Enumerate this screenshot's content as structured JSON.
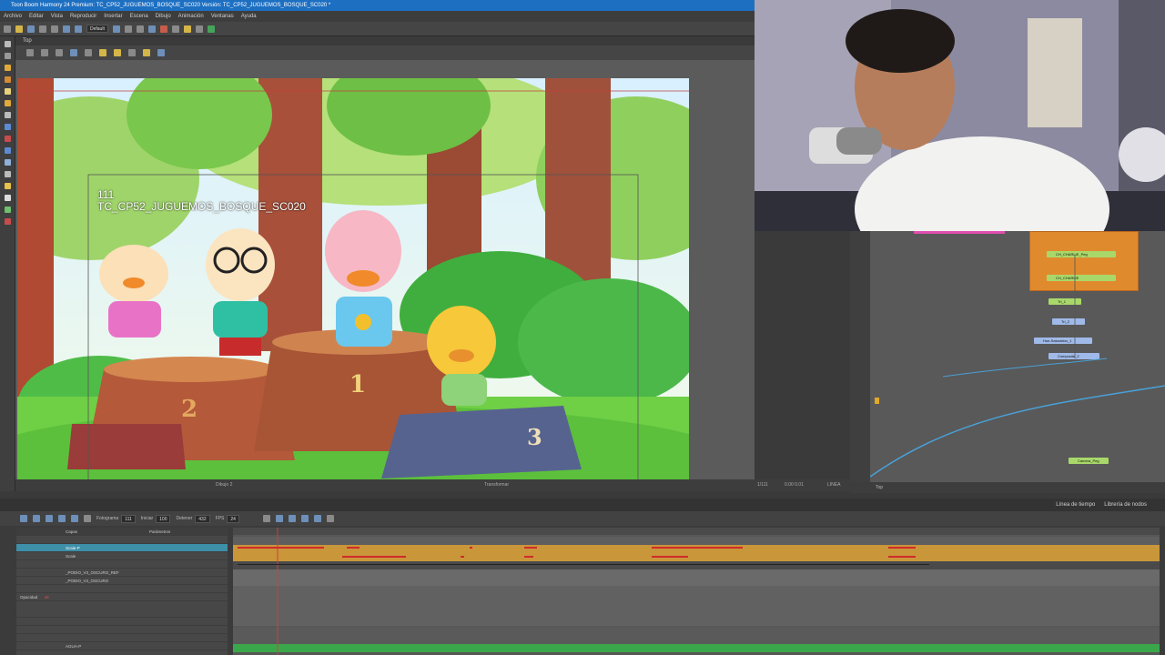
{
  "window": {
    "title": "Toon Boom Harmony 24 Premium: TC_CP52_JUGUEMOS_BOSQUE_SC020 Versión: TC_CP52_JUGUEMOS_BOSQUE_SC020 *"
  },
  "menu": [
    "Archivo",
    "Editar",
    "Vista",
    "Reproducir",
    "Insertar",
    "Escena",
    "Dibujo",
    "Animación",
    "Ventanas",
    "Ayuda"
  ],
  "toolbar": {
    "workspace": "Default"
  },
  "camera": {
    "tab": "Top",
    "frame_number": "111",
    "scene_name": "TC_CP52_JUGUEMOS_BOSQUE_SC020",
    "status_left": "Dibujo 2",
    "status_mid": "Transformar",
    "status_frame": "1/111",
    "status_coords": "0.00 0.01",
    "status_right": "LINEA"
  },
  "node_view": {
    "footer": "Top",
    "nodes": [
      "CH_CHARLIE_Peg",
      "CH_CHARLIE",
      "Tri_1",
      "Tri_2",
      "Hue-Saturation_1",
      "Composite_2",
      "Camera_Peg"
    ]
  },
  "timeline": {
    "tab_timeline": "Línea de tiempo",
    "tab_nodes": "Librería de nodos",
    "frame_label": "Fotograma",
    "frame_value": "111",
    "start_label": "Iniciar",
    "start_value": "100",
    "stop_label": "Detener",
    "stop_value": "432",
    "fps_label": "FPS",
    "fps_value": "24",
    "col_layers": "Capas",
    "col_params": "Parámetros",
    "opacity_label": "Opacidad",
    "opacity_value": "40",
    "layers": [
      "",
      "Scale-P",
      "Scale",
      "",
      "_PODIO_V3_OSCURO_REF",
      "_PODIO_V3_OSCURO",
      "",
      "",
      "",
      "",
      "",
      "AGUA-P"
    ]
  },
  "colors": {
    "accent": "#1d6fc2",
    "track_orange": "#c9963a",
    "keyframe_red": "#d02a2a",
    "node_orange": "#e08a2e",
    "track_green": "#3aa84a"
  }
}
